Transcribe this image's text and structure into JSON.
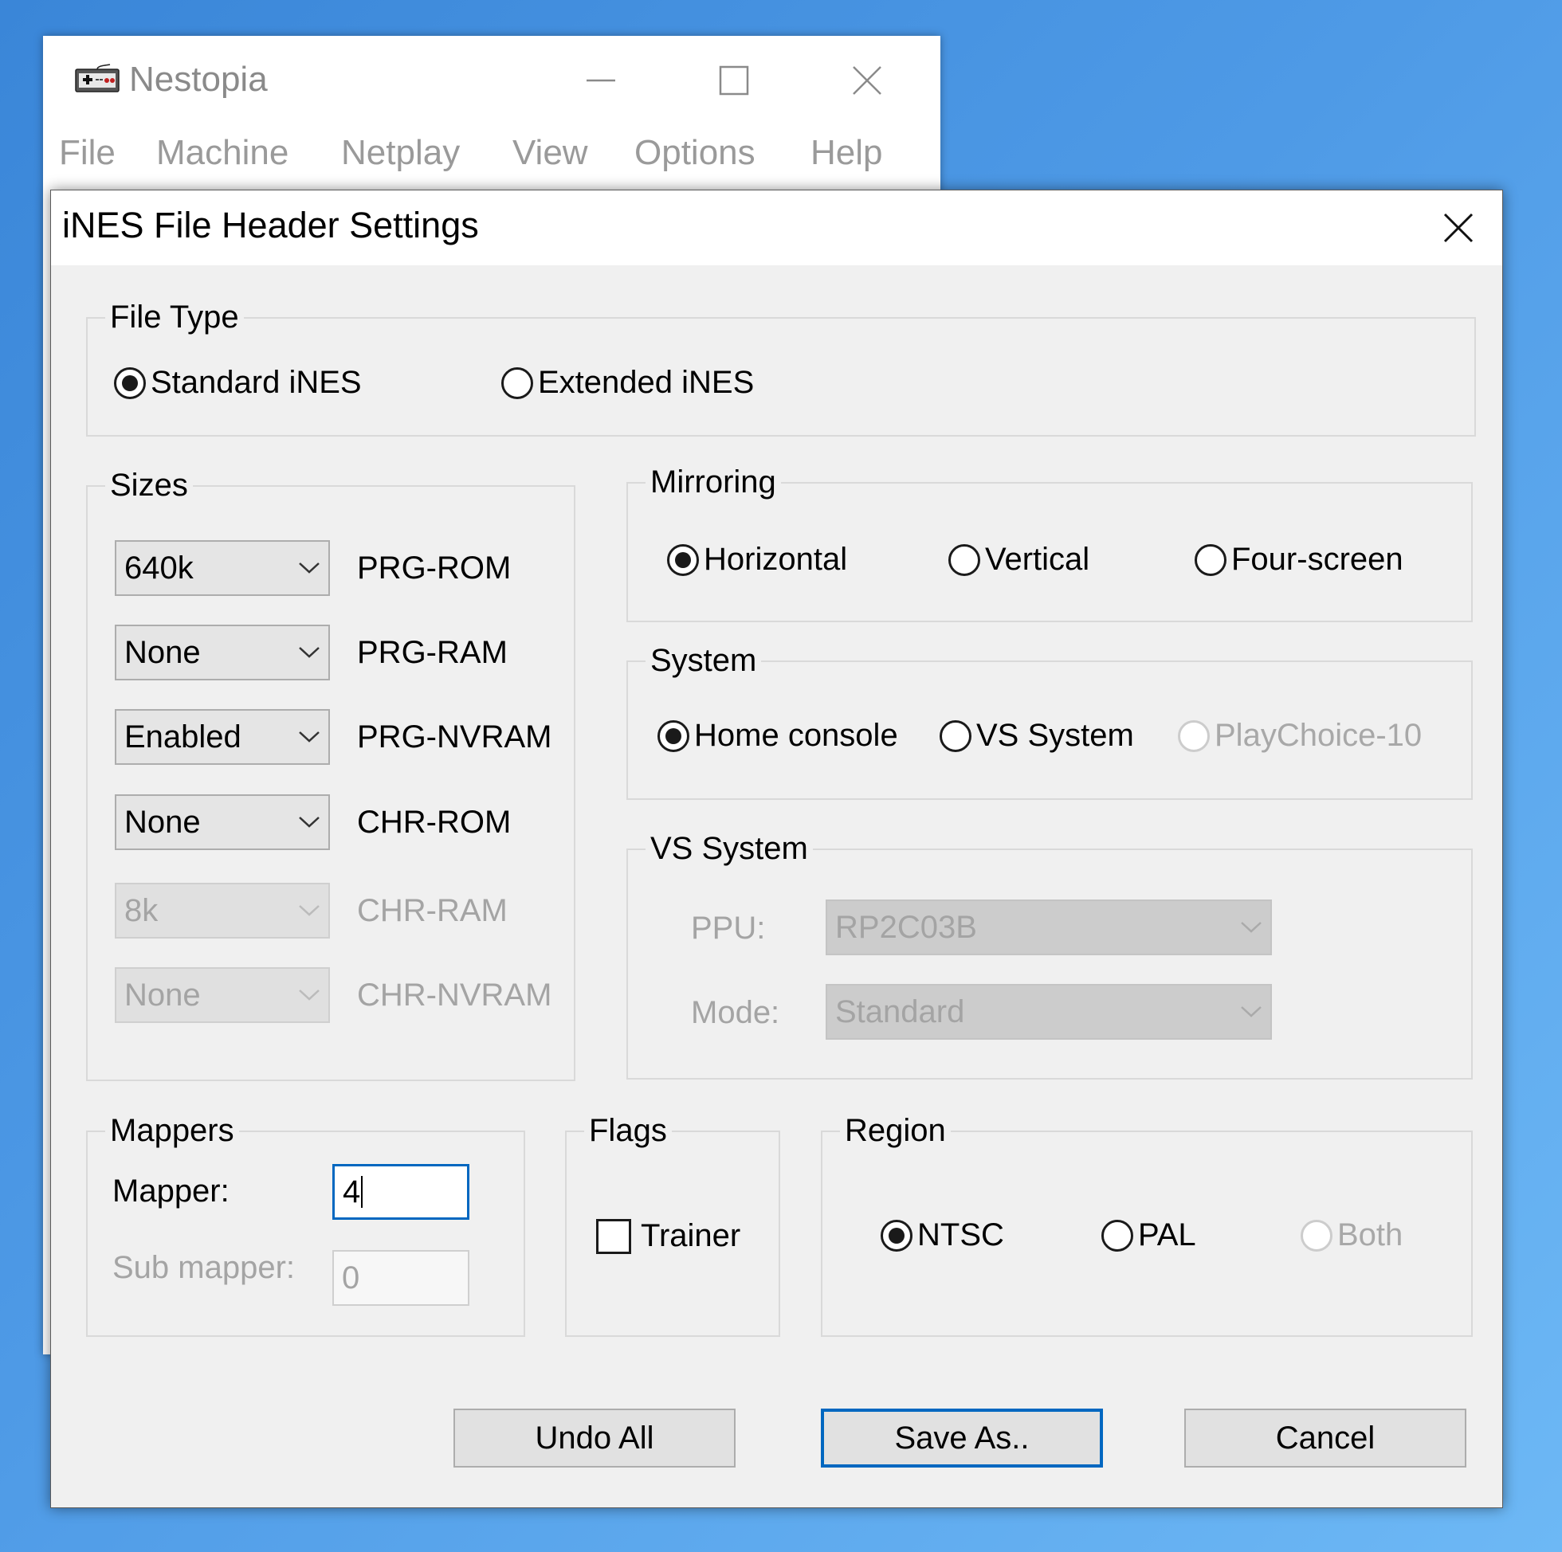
{
  "main_window": {
    "title": "Nestopia",
    "icon": "nes-controller-icon",
    "controls": [
      "minimize-icon",
      "maximize-icon",
      "close-icon"
    ],
    "menu": [
      "File",
      "Machine",
      "Netplay",
      "View",
      "Options",
      "Help"
    ]
  },
  "dialog": {
    "title": "iNES File Header Settings",
    "file_type": {
      "label": "File Type",
      "options": [
        {
          "label": "Standard iNES",
          "checked": true
        },
        {
          "label": "Extended iNES",
          "checked": false
        }
      ]
    },
    "sizes": {
      "label": "Sizes",
      "rows": [
        {
          "value": "640k",
          "label": "PRG-ROM",
          "enabled": true
        },
        {
          "value": "None",
          "label": "PRG-RAM",
          "enabled": true
        },
        {
          "value": "Enabled",
          "label": "PRG-NVRAM",
          "enabled": true
        },
        {
          "value": "None",
          "label": "CHR-ROM",
          "enabled": true
        },
        {
          "value": "8k",
          "label": "CHR-RAM",
          "enabled": false
        },
        {
          "value": "None",
          "label": "CHR-NVRAM",
          "enabled": false
        }
      ]
    },
    "mirroring": {
      "label": "Mirroring",
      "options": [
        {
          "label": "Horizontal",
          "checked": true
        },
        {
          "label": "Vertical",
          "checked": false
        },
        {
          "label": "Four-screen",
          "checked": false
        }
      ]
    },
    "system": {
      "label": "System",
      "options": [
        {
          "label": "Home console",
          "checked": true
        },
        {
          "label": "VS System",
          "checked": false
        },
        {
          "label": "PlayChoice-10",
          "checked": false,
          "disabled": true
        }
      ]
    },
    "vs_system": {
      "label": "VS System",
      "ppu_label": "PPU:",
      "ppu_value": "RP2C03B",
      "mode_label": "Mode:",
      "mode_value": "Standard"
    },
    "mappers": {
      "label": "Mappers",
      "mapper_label": "Mapper:",
      "mapper_value": "4",
      "sub_mapper_label": "Sub mapper:",
      "sub_mapper_value": "0"
    },
    "flags": {
      "label": "Flags",
      "trainer_label": "Trainer",
      "trainer_checked": false
    },
    "region": {
      "label": "Region",
      "options": [
        {
          "label": "NTSC",
          "checked": true
        },
        {
          "label": "PAL",
          "checked": false
        },
        {
          "label": "Both",
          "checked": false,
          "disabled": true
        }
      ]
    },
    "buttons": {
      "undo_all": "Undo All",
      "save_as": "Save As..",
      "cancel": "Cancel"
    }
  },
  "colors": {
    "accent": "#0067c0",
    "desktop": "#4e9ae6",
    "dialog_bg": "#f0f0f0"
  }
}
